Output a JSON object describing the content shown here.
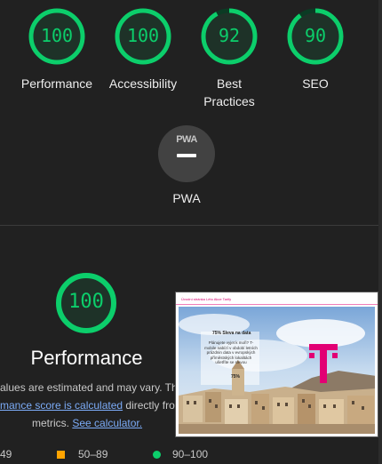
{
  "summary": [
    {
      "name": "Performance",
      "score": "100",
      "fraction": 1.0
    },
    {
      "name": "Accessibility",
      "score": "100",
      "fraction": 1.0
    },
    {
      "name": "Best Practices",
      "line1": "Best",
      "line2": "Practices",
      "score": "92",
      "fraction": 0.92
    },
    {
      "name": "SEO",
      "score": "90",
      "fraction": 0.9
    }
  ],
  "pwa": {
    "label": "PWA",
    "logo": "PWA"
  },
  "performance": {
    "score": "100",
    "title": "Performance",
    "desc_line1": "alues are estimated and may vary. The",
    "desc_link": "mance score is calculated",
    "desc_line2_rest": " directly from",
    "desc_line3_pre": "metrics. ",
    "desc_link2": "See calculator."
  },
  "screenshot": {
    "nav": "Úvodní stránka   Léto   Akce   Tarify",
    "title": "75% Sleva na data",
    "text": "Plánujete vyjet k moři? T-mobile nabízí v období letních prázdnin data v evropských příměstských lokalitách ušetříte se slevou",
    "percent": "75%",
    "logo": "T"
  },
  "legend": [
    {
      "range": "49",
      "color": "#ff4e42"
    },
    {
      "range": "50–89",
      "color": "#ffa400"
    },
    {
      "range": "90–100",
      "color": "#0cce6b"
    }
  ],
  "colors": {
    "pass": "#0cce6b",
    "average": "#ffa400",
    "background": "#212121"
  }
}
